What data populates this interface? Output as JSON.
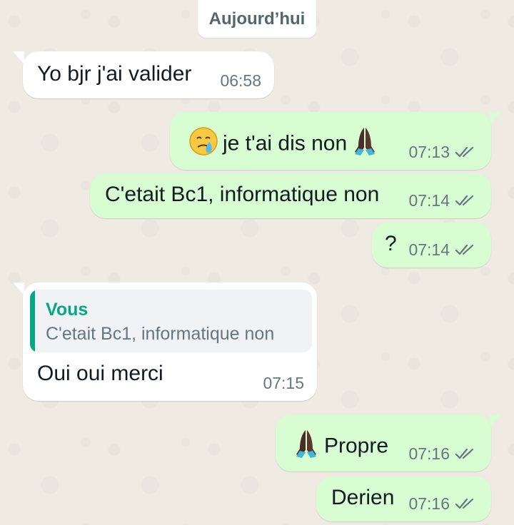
{
  "date_separator": "Aujourd’hui",
  "colors": {
    "background": "#efeae2",
    "incoming_bubble": "#ffffff",
    "outgoing_bubble": "#d9fdd3",
    "read_ticks": "#667781",
    "reply_accent": "#06a884"
  },
  "messages": [
    {
      "direction": "incoming",
      "text": "Yo bjr j'ai valider",
      "time": "06:58"
    },
    {
      "direction": "outgoing",
      "text": "je t'ai dis non",
      "icons": [
        "crying-face-emoji",
        "folded-hands-emoji"
      ],
      "time": "07:13",
      "status_icon": "double-check-icon"
    },
    {
      "direction": "outgoing",
      "text": "C'etait Bc1, informatique non",
      "time": "07:14",
      "status_icon": "double-check-icon"
    },
    {
      "direction": "outgoing",
      "text": "?",
      "time": "07:14",
      "status_icon": "double-check-icon"
    },
    {
      "direction": "incoming",
      "quoted_author": "Vous",
      "quoted_text": "C'etait Bc1, informatique non",
      "text": "Oui oui merci",
      "time": "07:15"
    },
    {
      "direction": "outgoing",
      "text": "Propre",
      "icons": [
        "folded-hands-emoji"
      ],
      "time": "07:16",
      "status_icon": "double-check-icon"
    },
    {
      "direction": "outgoing",
      "text": "Derien",
      "time": "07:16",
      "status_icon": "double-check-icon"
    }
  ]
}
